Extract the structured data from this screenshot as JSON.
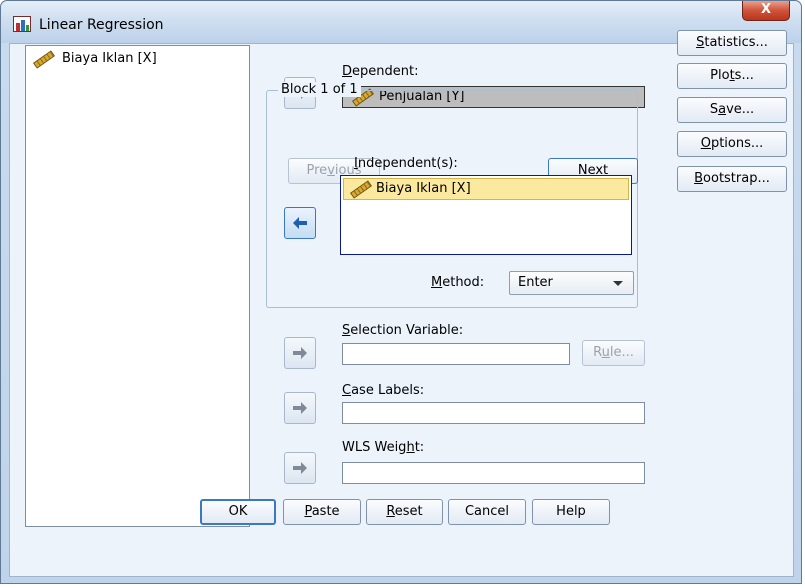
{
  "window": {
    "title": "Linear Regression",
    "close_label": "X"
  },
  "variable_list": {
    "items": [
      {
        "label": "Biaya Iklan [X]",
        "icon": "scale-ruler-icon"
      }
    ]
  },
  "dependent": {
    "label_u": "D",
    "label_rest": "ependent:",
    "value": "Penjualan [Y]"
  },
  "block": {
    "title": "Block 1 of 1",
    "previous_pre": "Pre",
    "previous_u": "v",
    "previous_post": "ious",
    "next_u": "N",
    "next_post": "ext",
    "independents_label_u": "I",
    "independents_label_rest": "ndependent(s):",
    "independents": [
      "Biaya Iklan [X]"
    ],
    "method_pre": "",
    "method_u": "M",
    "method_post": "ethod:",
    "method_value": "Enter"
  },
  "selection_variable": {
    "label_u": "S",
    "label_rest": "election Variable:",
    "value": "",
    "rule_pre": "R",
    "rule_u": "u",
    "rule_post": "le..."
  },
  "case_labels": {
    "label_pre": "",
    "label_u": "C",
    "label_rest": "ase Labels:",
    "value": ""
  },
  "wls_weight": {
    "label_pre": "WLS Weig",
    "label_u": "h",
    "label_rest": "t:",
    "value": ""
  },
  "side_buttons": {
    "statistics_u": "S",
    "statistics_post": "tatistics...",
    "plots_pre": "Plo",
    "plots_u": "t",
    "plots_post": "s...",
    "save_pre": "S",
    "save_u": "a",
    "save_post": "ve...",
    "options_u": "O",
    "options_post": "ptions...",
    "bootstrap_u": "B",
    "bootstrap_post": "ootstrap..."
  },
  "bottom_buttons": {
    "ok": "OK",
    "paste_u": "P",
    "paste_post": "aste",
    "reset_u": "R",
    "reset_post": "eset",
    "cancel": "Cancel",
    "help": "Help"
  },
  "colors": {
    "accent": "#3a78c2",
    "selection": "#fbe9a0",
    "dependent_fill": "#bdbdbd"
  }
}
